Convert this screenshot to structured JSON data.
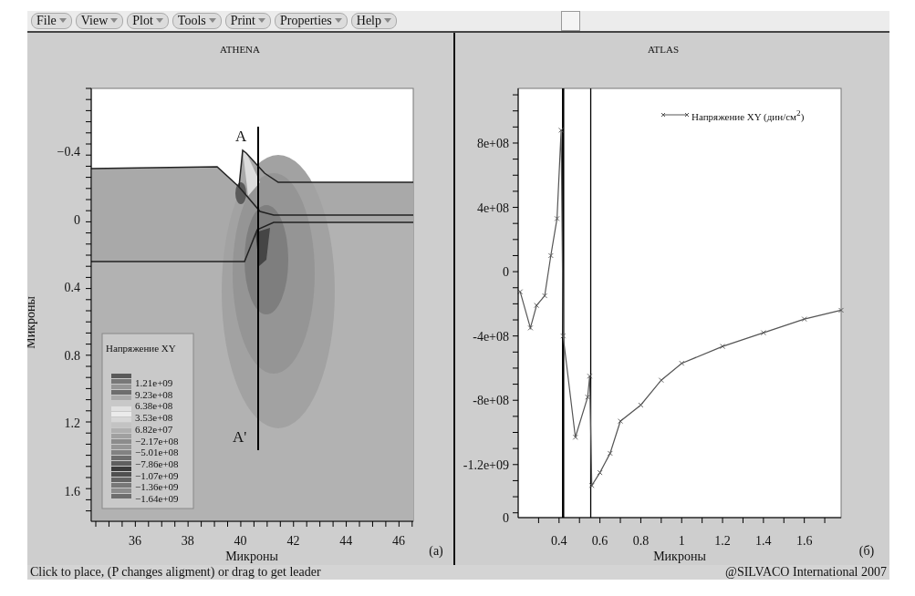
{
  "menu": [
    {
      "label": "File"
    },
    {
      "label": "View"
    },
    {
      "label": "Plot"
    },
    {
      "label": "Tools"
    },
    {
      "label": "Print"
    },
    {
      "label": "Properties"
    },
    {
      "label": "Help"
    }
  ],
  "left_panel": {
    "title": "ATHENA",
    "yticks": [
      "−0.4",
      "0",
      "0.4",
      "0.8",
      "1.2",
      "1.6"
    ],
    "xticks": [
      "36",
      "38",
      "40",
      "42",
      "44",
      "46"
    ],
    "xlabel": "Микроны",
    "ylabel": "Микроны",
    "cut_labels": [
      "A",
      "A'"
    ],
    "legend": {
      "title": "Напряжение XY",
      "values": [
        "1.21e+09",
        "9.23e+08",
        "6.38e+08",
        "3.53e+08",
        "6.82e+07",
        "−2.17e+08",
        "−5.01e+08",
        "−7.86e+08",
        "−1.07e+09",
        "−1.36e+09",
        "−1.64e+09"
      ]
    },
    "panel_label": "(a)"
  },
  "right_panel": {
    "title": "ATLAS",
    "panel_label": "(б)",
    "chart_data": {
      "type": "line",
      "xlabel": "Микроны",
      "xlim": [
        0.2,
        1.78
      ],
      "ylim": [
        -1530000000,
        1140000000
      ],
      "xticks": [
        0.4,
        0.6,
        0.8,
        1,
        1.2,
        1.4,
        1.6
      ],
      "yticks": [
        {
          "value": 800000000,
          "label": "8e+08"
        },
        {
          "value": 400000000,
          "label": "4e+08"
        },
        {
          "value": 0,
          "label": "0"
        },
        {
          "value": -400000000,
          "label": "-4e+08"
        },
        {
          "value": -800000000,
          "label": "-8e+08"
        },
        {
          "value": -1200000000,
          "label": "-1.2e+09"
        }
      ],
      "x": [
        0.21,
        0.26,
        0.29,
        0.33,
        0.36,
        0.39,
        0.41,
        0.42,
        0.48,
        0.54,
        0.55,
        0.56,
        0.6,
        0.65,
        0.7,
        0.8,
        0.9,
        1.0,
        1.2,
        1.4,
        1.6,
        1.78
      ],
      "series": [
        {
          "name": "Напряжение XY (дин/см$^{2}$)",
          "color": "#555555",
          "marker": "x",
          "values": [
            -125000000,
            -350000000,
            -210000000,
            -150000000,
            100000000,
            330000000,
            880000000,
            -400000000,
            -1030000000,
            -780000000,
            -650000000,
            -1330000000,
            -1250000000,
            -1130000000,
            -930000000,
            -830000000,
            -675000000,
            -570000000,
            -465000000,
            -380000000,
            -295000000,
            -240000000
          ]
        }
      ],
      "ref_lines": [
        {
          "axis": "x",
          "value": 0.42,
          "color": "#000000"
        },
        {
          "axis": "x",
          "value": 0.555,
          "color": "#000000"
        }
      ]
    },
    "bottom_tick_label": "0"
  },
  "status_bar": {
    "hint": "Click to place, (P changes aligment) or drag to get leader",
    "copyright": "@SILVACO International 2007"
  }
}
